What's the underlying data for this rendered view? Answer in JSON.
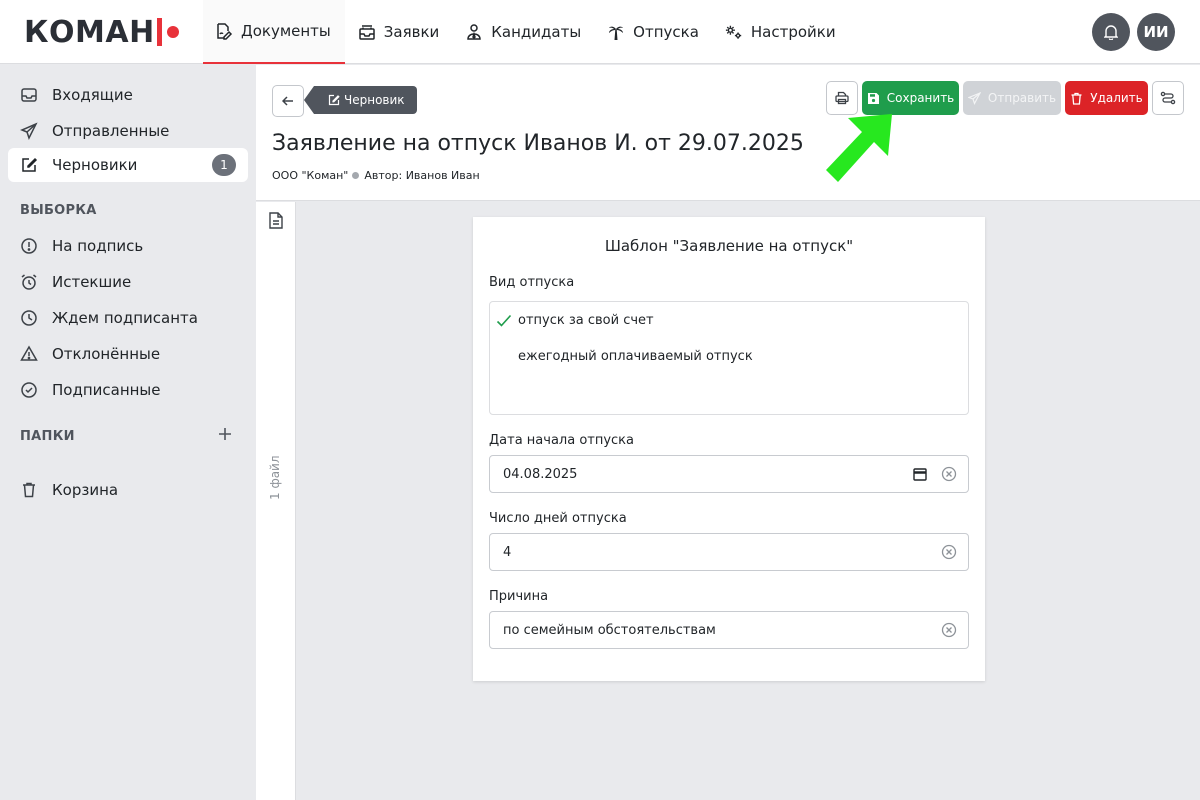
{
  "logo": {
    "text": "КОМАН"
  },
  "nav": {
    "documents": "Документы",
    "requests": "Заявки",
    "candidates": "Кандидаты",
    "vacations": "Отпуска",
    "settings": "Настройки"
  },
  "user": {
    "initials": "ИИ"
  },
  "sidebar": {
    "inbox": "Входящие",
    "sent": "Отправленные",
    "drafts": "Черновики",
    "drafts_count": "1",
    "selection_header": "ВЫБОРКА",
    "to_sign": "На подпись",
    "expired": "Истекшие",
    "waiting_signer": "Ждем подписанта",
    "rejected": "Отклонённые",
    "signed": "Подписанные",
    "folders_header": "ПАПКИ",
    "trash": "Корзина"
  },
  "document": {
    "status_badge": "Черновик",
    "title": "Заявление на отпуск Иванов И. от 29.07.2025",
    "organization": "ООО \"Коман\"",
    "author": "Автор: Иванов Иван"
  },
  "toolbar": {
    "save": "Сохранить",
    "send": "Отправить",
    "delete": "Удалить"
  },
  "files": {
    "count_label": "1 файл"
  },
  "form": {
    "template_title": "Шаблон \"Заявление на отпуск\"",
    "leave_type_label": "Вид отпуска",
    "leave_type_options": [
      "отпуск за свой счет",
      "ежегодный оплачиваемый отпуск"
    ],
    "start_date_label": "Дата начала отпуска",
    "start_date_value": "04.08.2025",
    "days_label": "Число дней отпуска",
    "days_value": "4",
    "reason_label": "Причина",
    "reason_value": "по семейным обстоятельствам"
  },
  "colors": {
    "accent_red": "#e8323a",
    "save_green": "#1f9d4c",
    "delete_red": "#dc2327",
    "badge_gray": "#50555d",
    "pointer_arrow": "#27e81f"
  }
}
